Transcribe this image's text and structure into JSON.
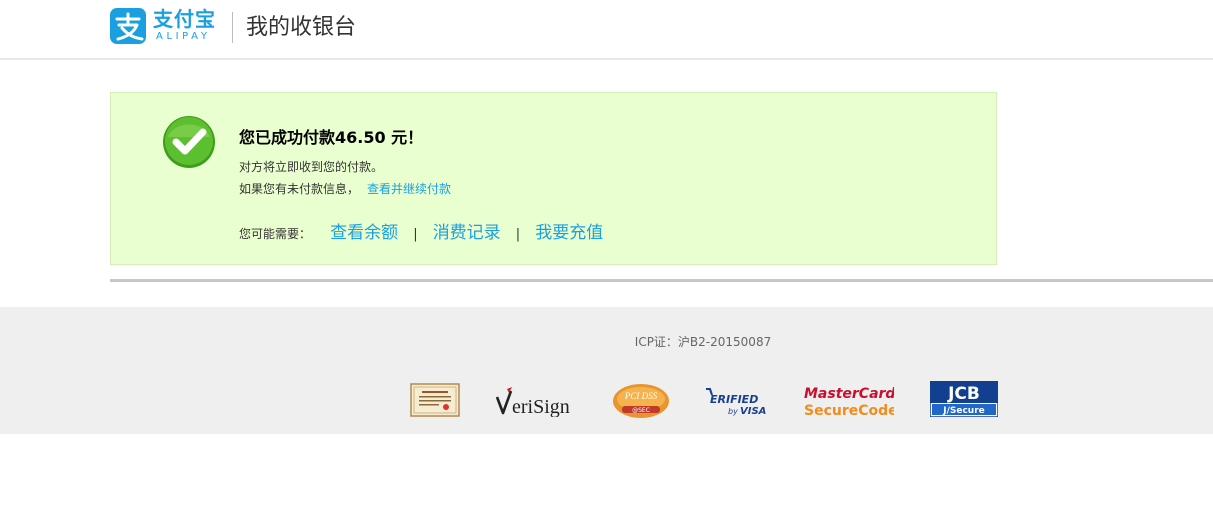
{
  "header": {
    "brand_cn": "支付宝",
    "brand_en": "ALIPAY",
    "title": "我的收银台"
  },
  "success": {
    "title": "您已成功付款46.50 元！",
    "line1": "对方将立即收到您的付款。",
    "line2_prefix": "如果您有未付款信息，",
    "line2_link": "查看并继续付款",
    "suggest_label": "您可能需要：",
    "links": [
      "查看余额",
      "消费记录",
      "我要充值"
    ],
    "separator": "|"
  },
  "footer": {
    "icp": "ICP证：沪B2-20150087",
    "badges": [
      "certificate-icon",
      "verisign-logo",
      "pci-dss-logo",
      "verified-by-visa-logo",
      "mastercard-securecode-logo",
      "jcb-jsecure-logo"
    ]
  },
  "colors": {
    "brand_blue": "#1aa0e0",
    "success_bg": "#eaffcf",
    "check_green": "#4caf2a",
    "footer_bg": "#efefef"
  }
}
